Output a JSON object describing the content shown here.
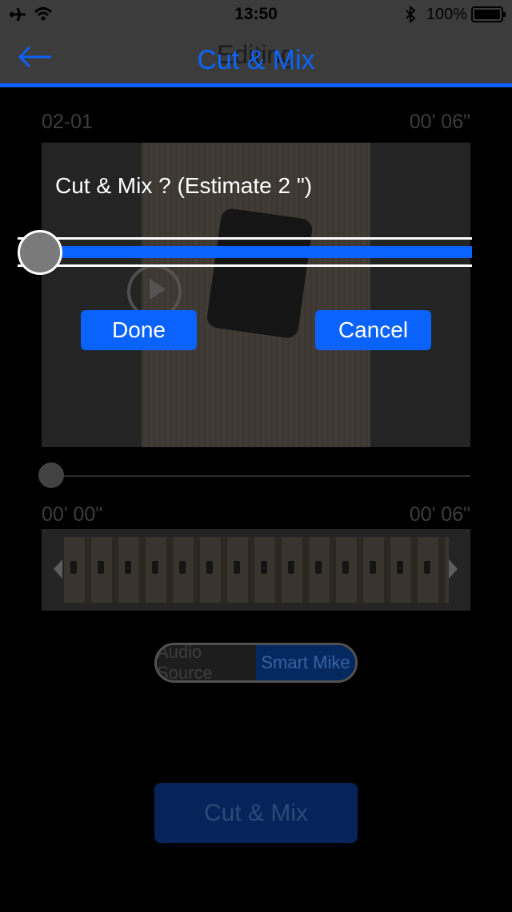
{
  "status_bar": {
    "time": "13:50",
    "battery_percent": "100%"
  },
  "nav": {
    "title_behind": "Editing",
    "title": "Cut & Mix",
    "accent_color": "#0a63ff"
  },
  "editor": {
    "clip_name": "02-01",
    "clip_duration": "00' 06\"",
    "range_start": "00' 00\"",
    "range_end": "00' 06\"",
    "segment": {
      "options": [
        "Audio Source",
        "Smart Mike"
      ],
      "selected": "Smart Mike"
    },
    "action_label": "Cut & Mix"
  },
  "dialog": {
    "title": "Cut & Mix ? (Estimate 2 \")",
    "progress": 0,
    "done_label": "Done",
    "cancel_label": "Cancel"
  }
}
